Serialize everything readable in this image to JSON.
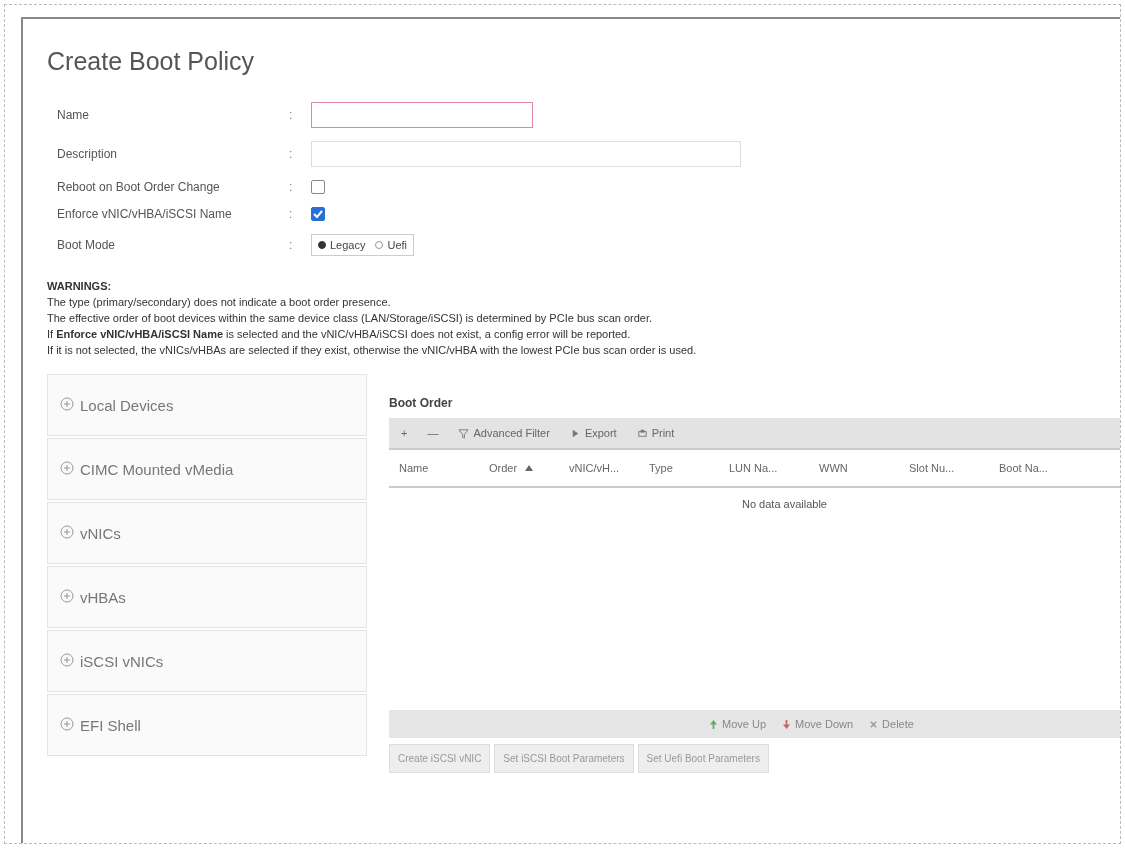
{
  "dialog": {
    "title": "Create Boot Policy"
  },
  "form": {
    "name": {
      "label": "Name",
      "separator": ":"
    },
    "description": {
      "label": "Description",
      "separator": ":"
    },
    "reboot": {
      "label": "Reboot on Boot Order Change",
      "separator": ":",
      "checked": false
    },
    "enforce": {
      "label": "Enforce vNIC/vHBA/iSCSI Name",
      "separator": ":",
      "checked": true
    },
    "boot_mode": {
      "label": "Boot Mode",
      "separator": ":",
      "options": [
        {
          "label": "Legacy",
          "selected": true
        },
        {
          "label": "Uefi",
          "selected": false
        }
      ]
    }
  },
  "warnings": {
    "title": "WARNINGS:",
    "lines": [
      "The type (primary/secondary) does not indicate a boot order presence.",
      "The effective order of boot devices within the same device class (LAN/Storage/iSCSI) is determined by PCIe bus scan order.",
      "If **Enforce vNIC/vHBA/iSCSI Name** is selected and the vNIC/vHBA/iSCSI does not exist, a config error will be reported.",
      "If it is not selected, the vNICs/vHBAs are selected if they exist, otherwise the vNIC/vHBA with the lowest PCIe bus scan order is used."
    ]
  },
  "devices": [
    {
      "label": "Local Devices",
      "expanded": false
    },
    {
      "label": "CIMC Mounted vMedia",
      "expanded": false
    },
    {
      "label": "vNICs",
      "expanded": false
    },
    {
      "label": "vHBAs",
      "expanded": false
    },
    {
      "label": "iSCSI vNICs",
      "expanded": false
    },
    {
      "label": "EFI Shell",
      "expanded": false
    }
  ],
  "boot_order": {
    "title": "Boot Order",
    "toolbar": [
      {
        "kind": "add",
        "label": "+"
      },
      {
        "kind": "remove",
        "label": "—"
      },
      {
        "kind": "filter",
        "label": "Advanced Filter"
      },
      {
        "kind": "export",
        "label": "Export"
      },
      {
        "kind": "print",
        "label": "Print"
      }
    ],
    "columns": [
      {
        "label": "Name",
        "sorted": false
      },
      {
        "label": "Order",
        "sorted": true
      },
      {
        "label": "vNIC/vH...",
        "sorted": false
      },
      {
        "label": "Type",
        "sorted": false
      },
      {
        "label": "LUN Na...",
        "sorted": false
      },
      {
        "label": "WWN",
        "sorted": false
      },
      {
        "label": "Slot Nu...",
        "sorted": false
      },
      {
        "label": "Boot Na...",
        "sorted": false
      }
    ],
    "empty_text": "No data available",
    "actions": [
      {
        "kind": "up",
        "label": "Move Up"
      },
      {
        "kind": "down",
        "label": "Move Down"
      },
      {
        "kind": "delete",
        "label": "Delete"
      }
    ],
    "buttons": [
      {
        "label": "Create iSCSI vNIC",
        "disabled": true
      },
      {
        "label": "Set iSCSI Boot Parameters",
        "disabled": true
      },
      {
        "label": "Set Uefi Boot Parameters",
        "disabled": true
      }
    ]
  }
}
